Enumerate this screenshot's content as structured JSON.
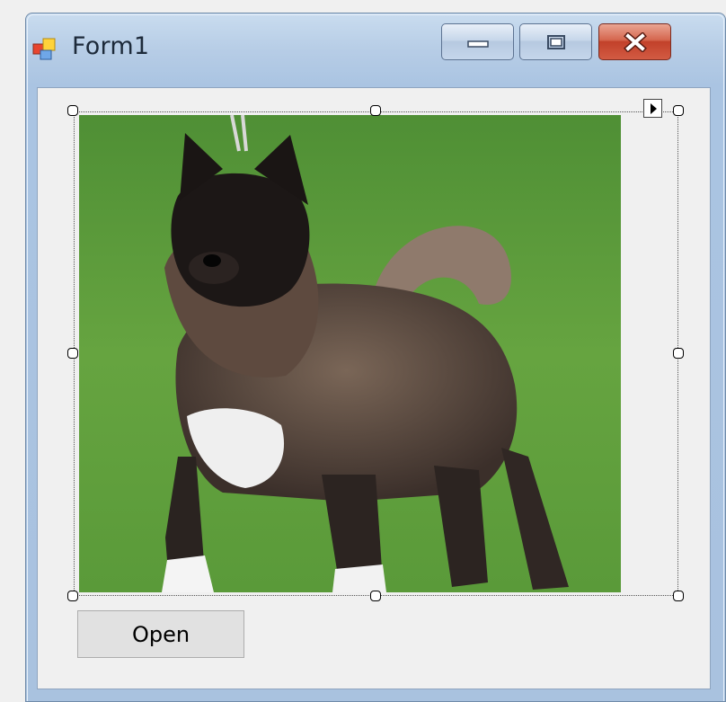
{
  "window": {
    "title": "Form1"
  },
  "caption_buttons": {
    "minimize_icon": "minimize-icon",
    "maximize_icon": "maximize-icon",
    "close_icon": "close-icon"
  },
  "form": {
    "open_button_label": "Open",
    "picture_content": "dog-photo"
  },
  "colors": {
    "grass": "#5f9a3a",
    "close_button": "#c9452d",
    "title_bar": "#b7cde6",
    "client_bg": "#f0f0f0"
  }
}
